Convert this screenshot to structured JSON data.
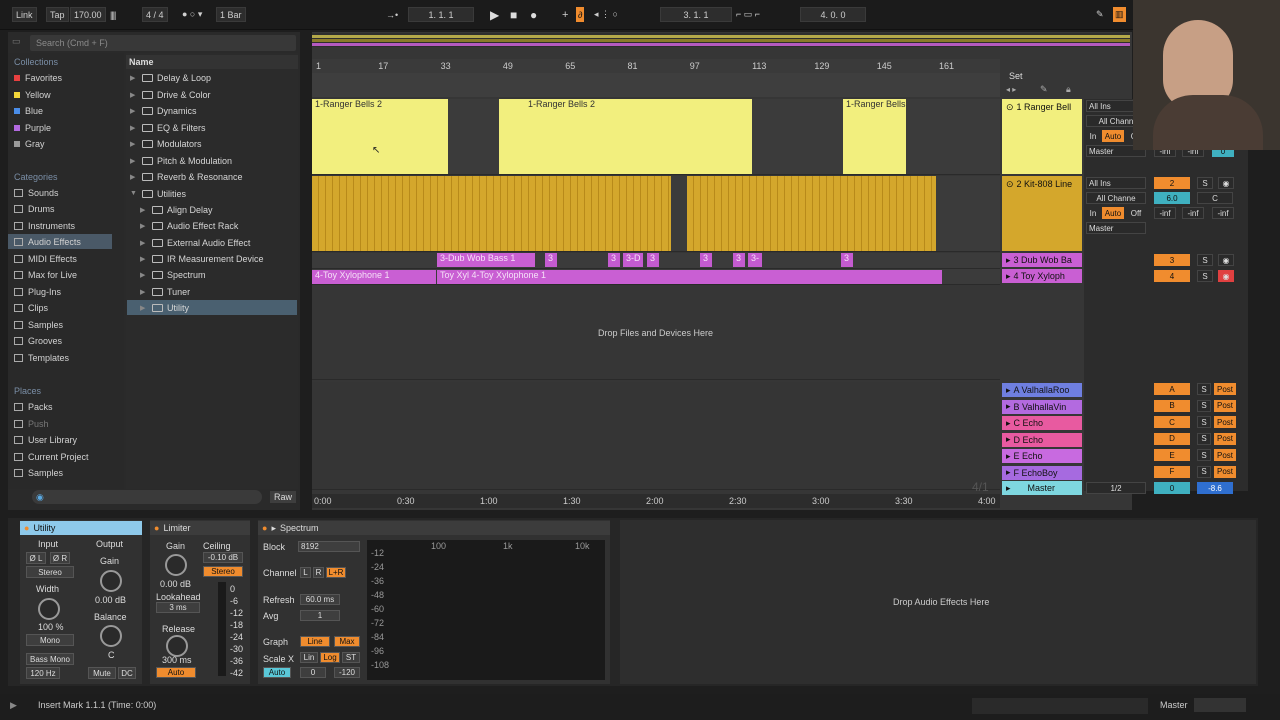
{
  "transport": {
    "link": "Link",
    "tap": "Tap",
    "tempo": "170.00",
    "sig": "4 / 4",
    "quant": "1 Bar",
    "pos1": "1. 1. 1",
    "pos2": "3. 1. 1",
    "pos3": "4. 0. 0"
  },
  "browser": {
    "search_placeholder": "Search (Cmd + F)",
    "collections_title": "Collections",
    "collections": [
      {
        "label": "Favorites",
        "color": "#e84040"
      },
      {
        "label": "Yellow",
        "color": "#f3d63a"
      },
      {
        "label": "Blue",
        "color": "#4a8de8"
      },
      {
        "label": "Purple",
        "color": "#b36ae0"
      },
      {
        "label": "Gray",
        "color": "#9a9a9a"
      }
    ],
    "categories_title": "Categories",
    "categories": [
      "Sounds",
      "Drums",
      "Instruments",
      "Audio Effects",
      "MIDI Effects",
      "Max for Live",
      "Plug-Ins",
      "Clips",
      "Samples",
      "Grooves",
      "Templates"
    ],
    "places_title": "Places",
    "places": [
      "Packs",
      "Push",
      "User Library",
      "Current Project",
      "Samples"
    ],
    "name_header": "Name",
    "items": [
      "Delay & Loop",
      "Drive & Color",
      "Dynamics",
      "EQ & Filters",
      "Modulators",
      "Pitch & Modulation",
      "Reverb & Resonance",
      "Utilities"
    ],
    "sub_items": [
      "Align Delay",
      "Audio Effect Rack",
      "External Audio Effect",
      "IR Measurement Device",
      "Spectrum",
      "Tuner",
      "Utility"
    ],
    "raw": "Raw"
  },
  "arrangement": {
    "ruler": [
      "1",
      "17",
      "33",
      "49",
      "65",
      "81",
      "97",
      "113",
      "129",
      "145",
      "161"
    ],
    "set": "Set",
    "clips_bells": [
      "1-Ranger Bells 2",
      "1-Ranger Bells 2",
      "1-Ranger Bells"
    ],
    "clip_dub": "3-Dub Wob Bass 1",
    "clip_dub_small": [
      "3",
      "3",
      "3-D",
      "3",
      "3",
      "3",
      "3-",
      "3"
    ],
    "clip_xylo": "4-Toy Xylophone 1",
    "clip_xylo2": "Toy Xyl 4-Toy Xylophone 1",
    "drop_text": "Drop Files and Devices Here",
    "time": [
      "0:00",
      "0:30",
      "1:00",
      "1:30",
      "2:00",
      "2:30",
      "3:00",
      "3:30",
      "4:00"
    ],
    "sig_watermark": "4/1"
  },
  "tracks": [
    {
      "name": "1 Ranger Bell",
      "color": "#f2ef7e",
      "input": "All Ins",
      "chan": "All Chann",
      "in": "In",
      "auto": "Auto",
      "off": "Off",
      "out": "Master",
      "vals": [
        "-inf",
        "-inf",
        "0"
      ]
    },
    {
      "name": "2 Kit-808 Line",
      "color": "#d4a72c",
      "input": "All Ins",
      "chan": "All Channe",
      "in": "In",
      "auto": "Auto",
      "off": "Off",
      "out": "Master",
      "num": "2",
      "vol": "6.0",
      "pan": "C",
      "vals": [
        "-inf",
        "-inf",
        "-inf"
      ]
    },
    {
      "name": "3 Dub Wob Ba",
      "color": "#c95fd3",
      "num": "3"
    },
    {
      "name": "4 Toy Xyloph",
      "color": "#c95fd3",
      "num": "4"
    }
  ],
  "returns": [
    {
      "name": "A ValhallaRoo",
      "letter": "A",
      "color": "#6f7fe0"
    },
    {
      "name": "B ValhallaVin",
      "letter": "B",
      "color": "#b36ae0"
    },
    {
      "name": "C Echo",
      "letter": "C",
      "color": "#e85aa0"
    },
    {
      "name": "D Echo",
      "letter": "D",
      "color": "#e85aa0"
    },
    {
      "name": "E Echo",
      "letter": "E",
      "color": "#c86ae0"
    },
    {
      "name": "F EchoBoy",
      "letter": "F",
      "color": "#a66ae0"
    }
  ],
  "master": {
    "name": "Master",
    "sel": "1/2",
    "vol": "0",
    "db": "-8.6",
    "color": "#7ed7e0"
  },
  "mixlabels": {
    "s": "S",
    "post": "Post"
  },
  "utility": {
    "title": "Utility",
    "input": "Input",
    "output": "Output",
    "phase_l": "Ø L",
    "phase_r": "Ø R",
    "stereo": "Stereo",
    "width": "Width",
    "width_val": "100 %",
    "mono": "Mono",
    "gain": "Gain",
    "gain_val": "0.00 dB",
    "balance": "Balance",
    "balance_val": "C",
    "bass_mono": "Bass Mono",
    "hz": "120 Hz",
    "mute": "Mute",
    "dc": "DC"
  },
  "limiter": {
    "title": "Limiter",
    "gain": "Gain",
    "ceiling": "Ceiling",
    "ceiling_val": "-0.10 dB",
    "gain_val": "0.00 dB",
    "stereo": "Stereo",
    "lookahead": "Lookahead",
    "look_val": "3 ms",
    "release": "Release",
    "release_val": "300 ms",
    "auto": "Auto",
    "scale": [
      "0",
      "-6",
      "-12",
      "-18",
      "-24",
      "-30",
      "-36",
      "-42"
    ]
  },
  "spectrum": {
    "title": "Spectrum",
    "block": "Block",
    "block_val": "8192",
    "channel": "Channel",
    "ch_l": "L",
    "ch_r": "R",
    "ch_lr": "L+R",
    "refresh": "Refresh",
    "refresh_val": "60.0 ms",
    "avg": "Avg",
    "avg_val": "1",
    "graph": "Graph",
    "line": "Line",
    "max": "Max",
    "scale_x": "Scale X",
    "lin": "Lin",
    "log": "Log",
    "st": "ST",
    "auto": "Auto",
    "r0": "0",
    "r120": "-120",
    "db": [
      "-12",
      "-24",
      "-36",
      "-48",
      "-60",
      "-72",
      "-84",
      "-96",
      "-108"
    ],
    "freq": [
      "100",
      "1k",
      "10k"
    ]
  },
  "drop_effects": "Drop Audio Effects Here",
  "status": {
    "text": "Insert Mark 1.1.1 (Time: 0:00)",
    "master": "Master"
  }
}
